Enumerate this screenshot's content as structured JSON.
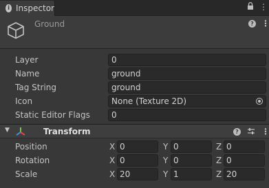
{
  "tab": {
    "title": "Inspector",
    "icon": "info-icon"
  },
  "tab_actions": {
    "lock": "🔒",
    "menu": "⋮"
  },
  "object": {
    "name": "Ground",
    "icon": "cube-icon"
  },
  "properties": [
    {
      "label": "Layer",
      "value": "0"
    },
    {
      "label": "Name",
      "value": "ground"
    },
    {
      "label": "Tag String",
      "value": "ground"
    },
    {
      "label": "Icon",
      "value": "None (Texture 2D)"
    },
    {
      "label": "Static Editor Flags",
      "value": "0"
    }
  ],
  "transform": {
    "title": "Transform",
    "rows": [
      {
        "label": "Position",
        "x": "0",
        "y": "0",
        "z": "0"
      },
      {
        "label": "Rotation",
        "x": "0",
        "y": "0",
        "z": "0"
      },
      {
        "label": "Scale",
        "x": "20",
        "y": "1",
        "z": "20"
      }
    ]
  },
  "axis_labels": {
    "x": "X",
    "y": "Y",
    "z": "Z"
  },
  "glyphs": {
    "help": "?",
    "kebab": "⋮",
    "sliders": "⇅",
    "fold": "▼",
    "info": "i"
  },
  "colors": {
    "background": "#383838",
    "field": "#2a2a2a",
    "tab_bar": "#282828"
  }
}
